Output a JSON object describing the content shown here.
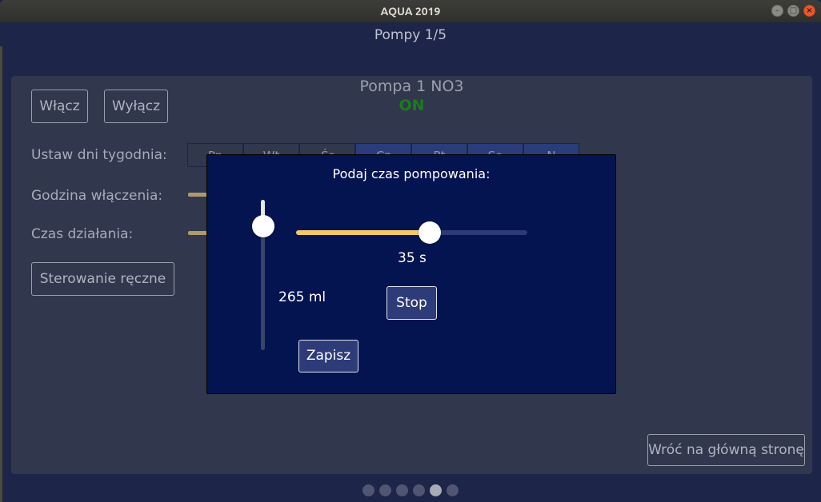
{
  "window": {
    "title": "AQUA 2019",
    "controls": [
      "minimize-icon",
      "maximize-icon",
      "close-icon"
    ]
  },
  "header": {
    "title": "Pompy 1/5"
  },
  "pump": {
    "name": "Pompa 1 NO3",
    "state": "ON",
    "state_color": "#1d7a1d"
  },
  "controls": {
    "on_label": "Włącz",
    "off_label": "Wyłącz",
    "days_label": "Ustaw dni tygodnia:",
    "days": [
      {
        "label": "Pn",
        "selected": false
      },
      {
        "label": "Wt",
        "selected": false
      },
      {
        "label": "Śr",
        "selected": false
      },
      {
        "label": "Cz",
        "selected": true
      },
      {
        "label": "Pt",
        "selected": true
      },
      {
        "label": "So",
        "selected": true
      },
      {
        "label": "N",
        "selected": true
      }
    ],
    "start_time_label": "Godzina włączenia:",
    "duration_label": "Czas działania:",
    "manual_label": "Sterowanie ręczne",
    "back_label": "Wróć na główną stronę"
  },
  "dialog": {
    "title": "Podaj czas pompowania:",
    "volume_value": "265 ml",
    "volume_slider_fraction": 0.85,
    "time_value": "35 s",
    "time_slider_fraction": 0.58,
    "stop_label": "Stop",
    "save_label": "Zapisz",
    "accent_color": "#f5c76a"
  },
  "pager": {
    "count": 6,
    "active_index": 4
  }
}
